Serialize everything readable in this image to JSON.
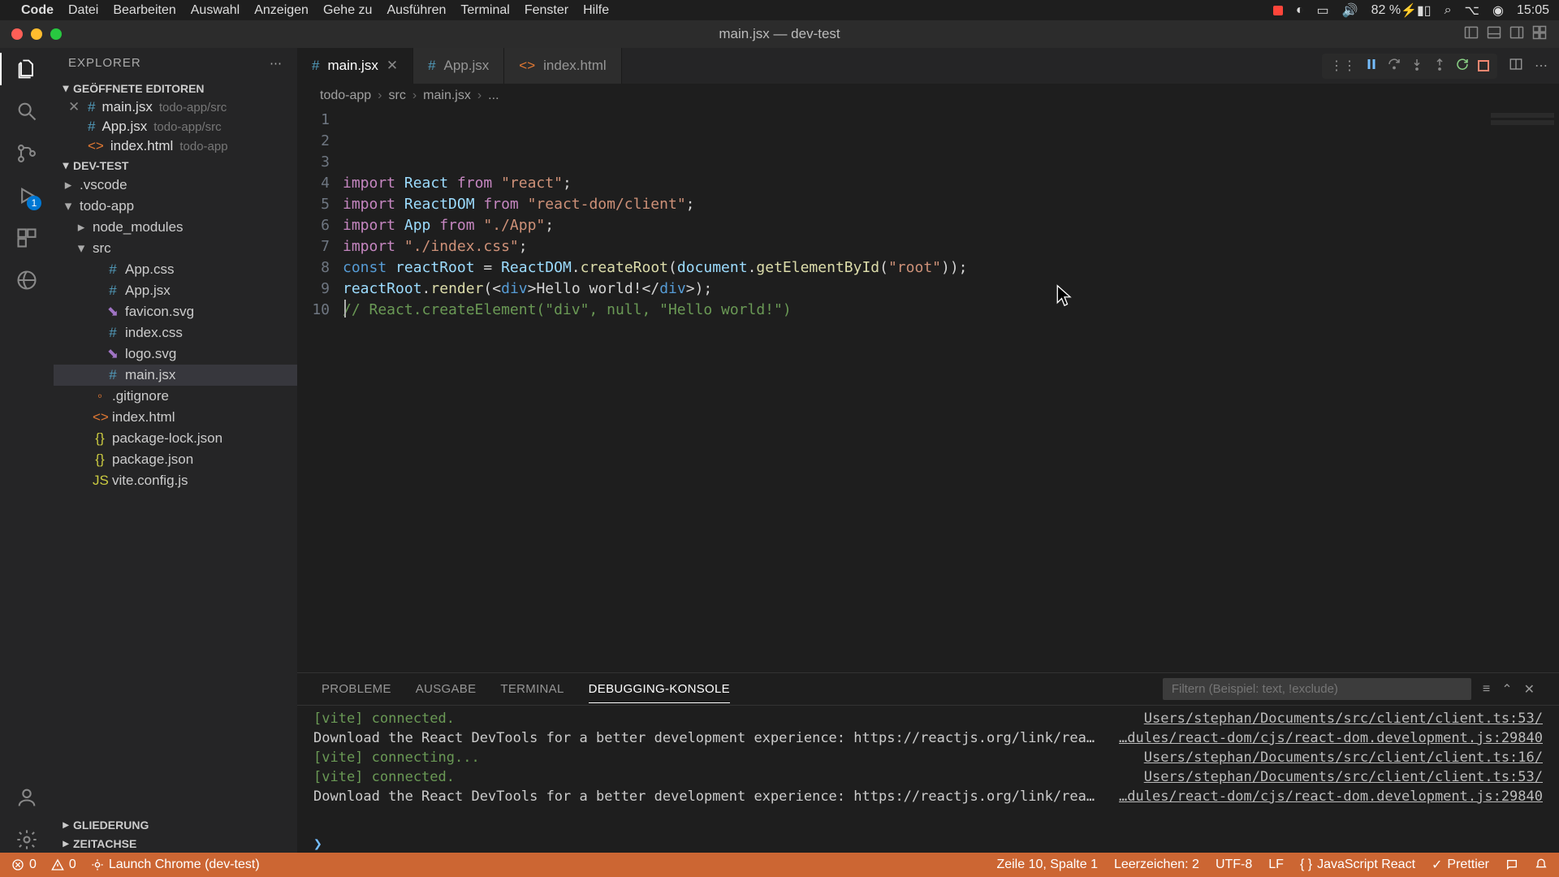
{
  "mac_menu": {
    "app": "Code",
    "items": [
      "Datei",
      "Bearbeiten",
      "Auswahl",
      "Anzeigen",
      "Gehe zu",
      "Ausführen",
      "Terminal",
      "Fenster",
      "Hilfe"
    ],
    "battery_pct": "82 %",
    "time": "15:05"
  },
  "window": {
    "title": "main.jsx — dev-test"
  },
  "sidebar": {
    "title": "EXPLORER",
    "sections": {
      "open_editors_label": "GEÖFFNETE EDITOREN",
      "workspace_label": "DEV-TEST",
      "outline_label": "GLIEDERUNG",
      "timeline_label": "ZEITACHSE"
    },
    "open_editors": [
      {
        "name": "main.jsx",
        "path": "todo-app/src",
        "active": true,
        "icon": "jsx"
      },
      {
        "name": "App.jsx",
        "path": "todo-app/src",
        "active": false,
        "icon": "jsx"
      },
      {
        "name": "index.html",
        "path": "todo-app",
        "active": false,
        "icon": "html"
      }
    ],
    "tree": [
      {
        "name": ".vscode",
        "type": "folder",
        "indent": 0,
        "expanded": false
      },
      {
        "name": "todo-app",
        "type": "folder",
        "indent": 0,
        "expanded": true
      },
      {
        "name": "node_modules",
        "type": "folder",
        "indent": 1,
        "expanded": false
      },
      {
        "name": "src",
        "type": "folder",
        "indent": 1,
        "expanded": true
      },
      {
        "name": "App.css",
        "type": "file",
        "indent": 2,
        "icon": "css"
      },
      {
        "name": "App.jsx",
        "type": "file",
        "indent": 2,
        "icon": "jsx"
      },
      {
        "name": "favicon.svg",
        "type": "file",
        "indent": 2,
        "icon": "svg"
      },
      {
        "name": "index.css",
        "type": "file",
        "indent": 2,
        "icon": "css"
      },
      {
        "name": "logo.svg",
        "type": "file",
        "indent": 2,
        "icon": "svg"
      },
      {
        "name": "main.jsx",
        "type": "file",
        "indent": 2,
        "icon": "jsx",
        "selected": true
      },
      {
        "name": ".gitignore",
        "type": "file",
        "indent": 1,
        "icon": "git"
      },
      {
        "name": "index.html",
        "type": "file",
        "indent": 1,
        "icon": "html"
      },
      {
        "name": "package-lock.json",
        "type": "file",
        "indent": 1,
        "icon": "json"
      },
      {
        "name": "package.json",
        "type": "file",
        "indent": 1,
        "icon": "json"
      },
      {
        "name": "vite.config.js",
        "type": "file",
        "indent": 1,
        "icon": "js"
      }
    ]
  },
  "activity_badge": "1",
  "tabs": [
    {
      "name": "main.jsx",
      "icon": "jsx",
      "active": true
    },
    {
      "name": "App.jsx",
      "icon": "jsx",
      "active": false
    },
    {
      "name": "index.html",
      "icon": "html",
      "active": false
    }
  ],
  "breadcrumb": [
    "todo-app",
    "src",
    "main.jsx",
    "..."
  ],
  "code": {
    "lines": [
      [
        {
          "t": "import ",
          "c": "tok-kw"
        },
        {
          "t": "React ",
          "c": "tok-var"
        },
        {
          "t": "from ",
          "c": "tok-kw"
        },
        {
          "t": "\"react\"",
          "c": "tok-str"
        },
        {
          "t": ";",
          "c": "tok-def"
        }
      ],
      [
        {
          "t": "import ",
          "c": "tok-kw"
        },
        {
          "t": "ReactDOM ",
          "c": "tok-var"
        },
        {
          "t": "from ",
          "c": "tok-kw"
        },
        {
          "t": "\"react-dom/client\"",
          "c": "tok-str"
        },
        {
          "t": ";",
          "c": "tok-def"
        }
      ],
      [
        {
          "t": "import ",
          "c": "tok-kw"
        },
        {
          "t": "App ",
          "c": "tok-var"
        },
        {
          "t": "from ",
          "c": "tok-kw"
        },
        {
          "t": "\"./App\"",
          "c": "tok-str"
        },
        {
          "t": ";",
          "c": "tok-def"
        }
      ],
      [
        {
          "t": "import ",
          "c": "tok-kw"
        },
        {
          "t": "\"./index.css\"",
          "c": "tok-str"
        },
        {
          "t": ";",
          "c": "tok-def"
        }
      ],
      [
        {
          "t": "",
          "c": ""
        }
      ],
      [
        {
          "t": "const ",
          "c": "tok-const"
        },
        {
          "t": "reactRoot ",
          "c": "tok-var"
        },
        {
          "t": "= ",
          "c": "tok-def"
        },
        {
          "t": "ReactDOM",
          "c": "tok-var"
        },
        {
          "t": ".",
          "c": "tok-def"
        },
        {
          "t": "createRoot",
          "c": "tok-fn"
        },
        {
          "t": "(",
          "c": "tok-def"
        },
        {
          "t": "document",
          "c": "tok-var"
        },
        {
          "t": ".",
          "c": "tok-def"
        },
        {
          "t": "getElementById",
          "c": "tok-fn"
        },
        {
          "t": "(",
          "c": "tok-def"
        },
        {
          "t": "\"root\"",
          "c": "tok-str"
        },
        {
          "t": "));",
          "c": "tok-def"
        }
      ],
      [
        {
          "t": "reactRoot",
          "c": "tok-var"
        },
        {
          "t": ".",
          "c": "tok-def"
        },
        {
          "t": "render",
          "c": "tok-fn"
        },
        {
          "t": "(",
          "c": "tok-def"
        },
        {
          "t": "<",
          "c": "tok-def"
        },
        {
          "t": "div",
          "c": "tok-tag"
        },
        {
          "t": ">",
          "c": "tok-def"
        },
        {
          "t": "Hello world!",
          "c": "tok-def"
        },
        {
          "t": "</",
          "c": "tok-def"
        },
        {
          "t": "div",
          "c": "tok-tag"
        },
        {
          "t": ">",
          "c": "tok-def"
        },
        {
          "t": ");",
          "c": "tok-def"
        }
      ],
      [
        {
          "t": "",
          "c": ""
        }
      ],
      [
        {
          "t": "// React.createElement(\"div\", null, \"Hello world!\")",
          "c": "tok-com"
        }
      ],
      [
        {
          "t": "",
          "c": ""
        }
      ]
    ]
  },
  "panel": {
    "tabs": [
      "PROBLEME",
      "AUSGABE",
      "TERMINAL",
      "DEBUGGING-KONSOLE"
    ],
    "active_tab": 3,
    "filter_placeholder": "Filtern (Beispiel: text, !exclude)",
    "lines": [
      {
        "left": "[vite] connected.",
        "lc": "col-green",
        "right": "Users/stephan/Documents/src/client/client.ts:53/"
      },
      {
        "left": "Download the React DevTools for a better development experience: https://reactjs.org/link/react-devtools",
        "lc": "",
        "right": "…dules/react-dom/cjs/react-dom.development.js:29840"
      },
      {
        "left": "[vite] connecting...",
        "lc": "col-green",
        "right": "Users/stephan/Documents/src/client/client.ts:16/"
      },
      {
        "left": "[vite] connected.",
        "lc": "col-green",
        "right": "Users/stephan/Documents/src/client/client.ts:53/"
      },
      {
        "left": "Download the React DevTools for a better development experience: https://reactjs.org/link/react-devtools",
        "lc": "",
        "right": "…dules/react-dom/cjs/react-dom.development.js:29840"
      }
    ]
  },
  "status": {
    "errors": "0",
    "warnings": "0",
    "launch": "Launch Chrome (dev-test)",
    "position": "Zeile 10, Spalte 1",
    "spaces": "Leerzeichen: 2",
    "encoding": "UTF-8",
    "eol": "LF",
    "lang": "JavaScript React",
    "prettier": "Prettier"
  }
}
